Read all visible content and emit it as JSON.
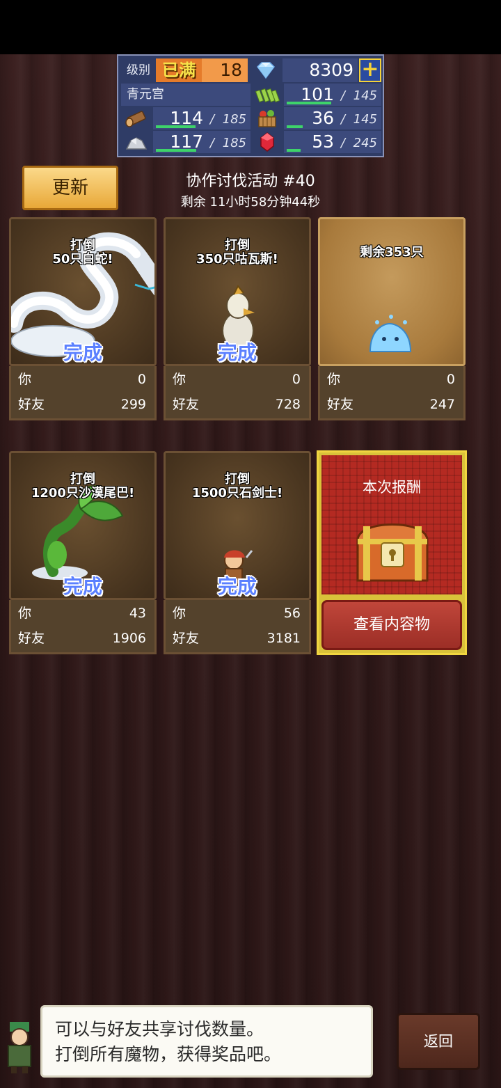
{
  "status": {
    "level_label": "级别",
    "level_max": "已满",
    "level": "18",
    "gems": "8309",
    "town_name": "青元宫",
    "resources": [
      {
        "icon": "grass-icon",
        "current": "101",
        "max": "145",
        "fill": 0.7
      },
      {
        "icon": "wood-log-icon",
        "current": "114",
        "max": "185",
        "fill": 0.62
      },
      {
        "icon": "food-basket-icon",
        "current": "36",
        "max": "145",
        "fill": 0.25
      },
      {
        "icon": "ore-icon",
        "current": "117",
        "max": "185",
        "fill": 0.63
      },
      {
        "icon": "ruby-icon",
        "current": "53",
        "max": "245",
        "fill": 0.22
      }
    ]
  },
  "header": {
    "update_label": "更新",
    "event_title": "协作讨伐活动 #40",
    "timer": "剩余 11小时58分钟44秒"
  },
  "cards": [
    {
      "line1": "打倒",
      "line2": "50只白蛇!",
      "done": "完成",
      "you_label": "你",
      "you": "0",
      "friend_label": "好友",
      "friend": "299"
    },
    {
      "line1": "打倒",
      "line2": "350只咕瓦斯!",
      "done": "完成",
      "you_label": "你",
      "you": "0",
      "friend_label": "好友",
      "friend": "728"
    },
    {
      "remaining": "剩余353只",
      "you_label": "你",
      "you": "0",
      "friend_label": "好友",
      "friend": "247"
    },
    {
      "line1": "打倒",
      "line2": "1200只沙漠尾巴!",
      "done": "完成",
      "you_label": "你",
      "you": "43",
      "friend_label": "好友",
      "friend": "1906"
    },
    {
      "line1": "打倒",
      "line2": "1500只石剑士!",
      "done": "完成",
      "you_label": "你",
      "you": "56",
      "friend_label": "好友",
      "friend": "3181"
    }
  ],
  "reward": {
    "title": "本次报酬",
    "button": "查看内容物"
  },
  "dialog": {
    "line1": "可以与好友共享讨伐数量。",
    "line2": "打倒所有魔物，获得奖品吧。"
  },
  "back_label": "返回"
}
